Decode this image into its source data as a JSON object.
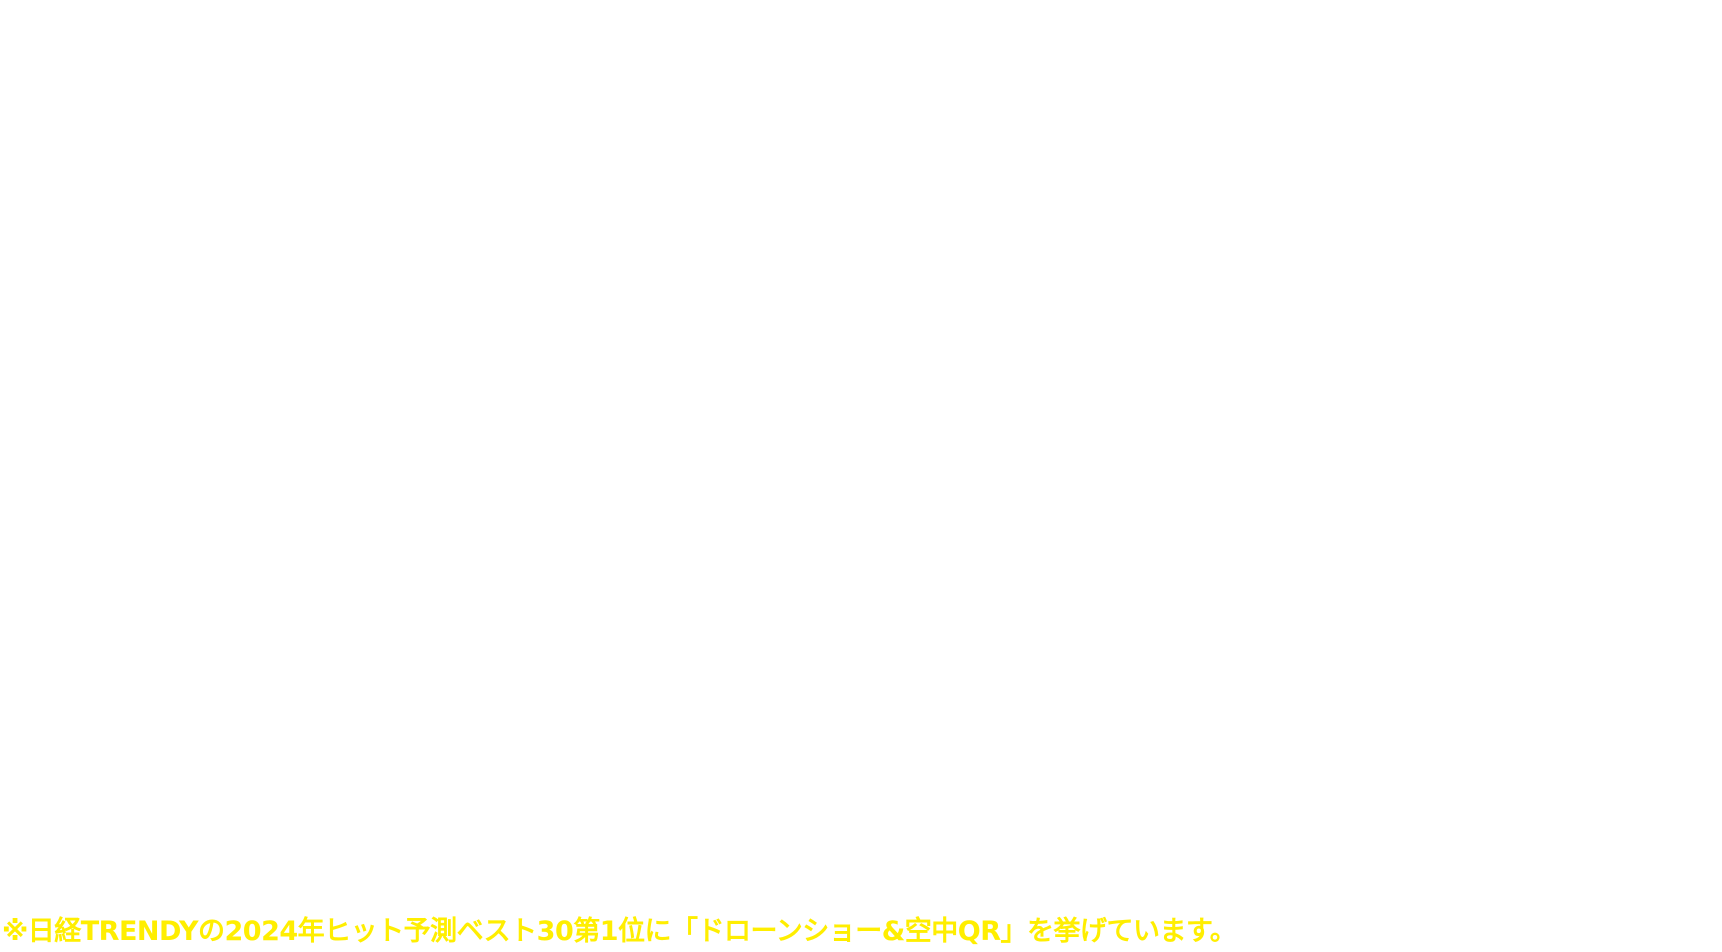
{
  "footnote": {
    "text": "※日経TRENDYの2024年ヒット予測ベスト30第1位に「ドローンショー&空中QR」を挙げています。",
    "color": "#ffee00"
  }
}
